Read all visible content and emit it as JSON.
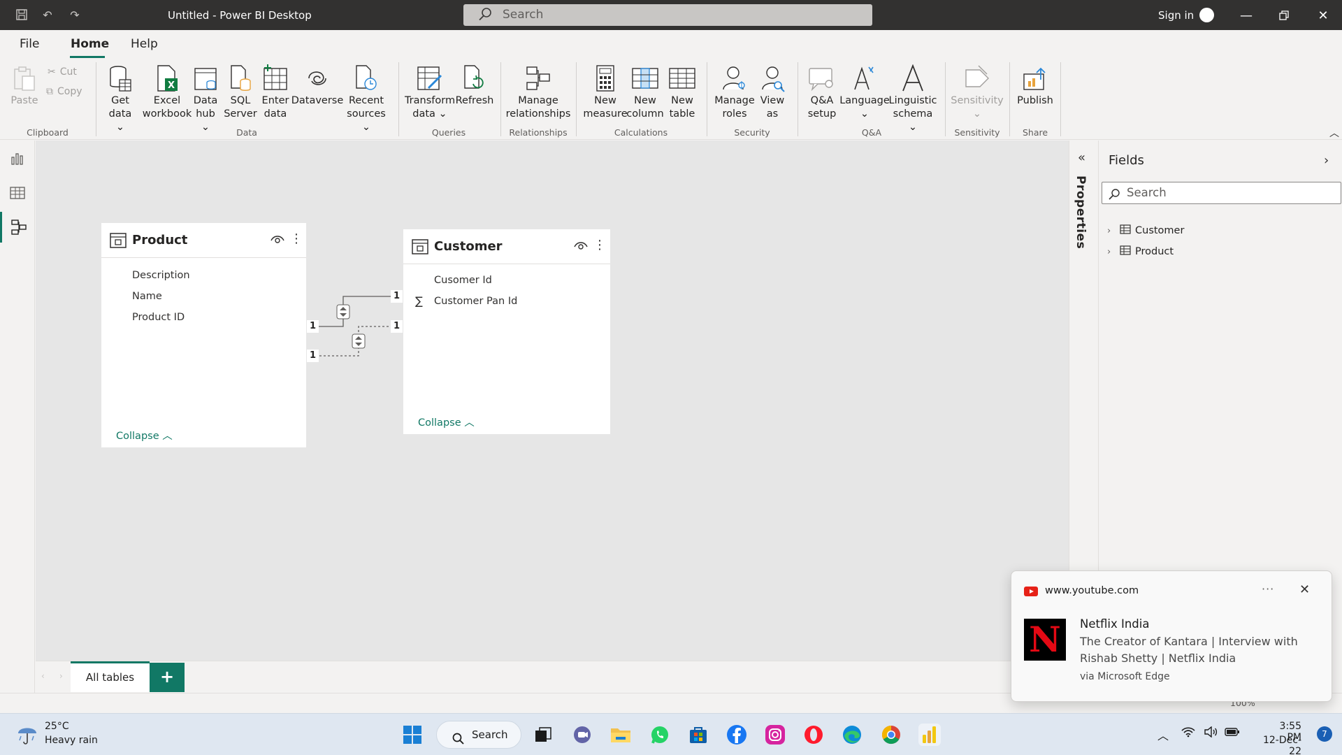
{
  "window": {
    "title": "Untitled - Power BI Desktop",
    "search_placeholder": "Search",
    "signin": "Sign in"
  },
  "menu": {
    "tabs": [
      "File",
      "Home",
      "Help"
    ],
    "active": "Home"
  },
  "ribbon": {
    "clipboard": {
      "paste": "Paste",
      "cut": "Cut",
      "copy": "Copy",
      "group": "Clipboard"
    },
    "data": {
      "get_data": [
        "Get",
        "data"
      ],
      "excel": [
        "Excel",
        "workbook"
      ],
      "data_hub": [
        "Data",
        "hub"
      ],
      "sql": [
        "SQL",
        "Server"
      ],
      "enter": [
        "Enter",
        "data"
      ],
      "dataverse": "Dataverse",
      "recent": [
        "Recent",
        "sources"
      ],
      "group": "Data"
    },
    "queries": {
      "transform": [
        "Transform",
        "data"
      ],
      "refresh": "Refresh",
      "group": "Queries"
    },
    "relationships": {
      "manage": [
        "Manage",
        "relationships"
      ],
      "group": "Relationships"
    },
    "calculations": {
      "new_measure": [
        "New",
        "measure"
      ],
      "new_column": [
        "New",
        "column"
      ],
      "new_table": [
        "New",
        "table"
      ],
      "group": "Calculations"
    },
    "security": {
      "manage_roles": [
        "Manage",
        "roles"
      ],
      "view_as": [
        "View",
        "as"
      ],
      "group": "Security"
    },
    "qa": {
      "setup": [
        "Q&A",
        "setup"
      ],
      "language": "Language",
      "schema": [
        "Linguistic",
        "schema"
      ],
      "group": "Q&A"
    },
    "sensitivity": {
      "label": "Sensitivity",
      "group": "Sensitivity"
    },
    "share": {
      "publish": "Publish",
      "group": "Share"
    }
  },
  "model": {
    "tables": [
      {
        "name": "Product",
        "fields": [
          "Description",
          "Name",
          "Product ID"
        ],
        "collapse": "Collapse"
      },
      {
        "name": "Customer",
        "fields": [
          "Cusomer Id",
          "Customer Pan Id"
        ],
        "collapse": "Collapse"
      }
    ],
    "relationships": [
      {
        "from": "Product",
        "to": "Customer",
        "from_card": "1",
        "to_card": "1",
        "active": true
      },
      {
        "from": "Product",
        "to": "Customer",
        "from_card": "1",
        "to_card": "1",
        "active": false
      }
    ]
  },
  "properties": {
    "label": "Properties"
  },
  "fields_pane": {
    "title": "Fields",
    "search_placeholder": "Search",
    "tables": [
      "Customer",
      "Product"
    ]
  },
  "pages": {
    "tabs": [
      "All tables"
    ],
    "add": "+"
  },
  "status": {
    "zoom": "100%"
  },
  "toast": {
    "site": "www.youtube.com",
    "heading": "Netflix India",
    "body": "The Creator of Kantara | Interview with Rishab Shetty | Netflix India",
    "via": "via Microsoft Edge",
    "more": "···",
    "thumb_letter": "N"
  },
  "taskbar": {
    "weather_temp": "25°C",
    "weather_desc": "Heavy rain",
    "search": "Search",
    "time": "3:55 PM",
    "date": "12-Dec-22",
    "notification_count": "7"
  },
  "colors": {
    "accent": "#117865",
    "titlebar": "#323130",
    "canvas": "#e6e6e6"
  }
}
